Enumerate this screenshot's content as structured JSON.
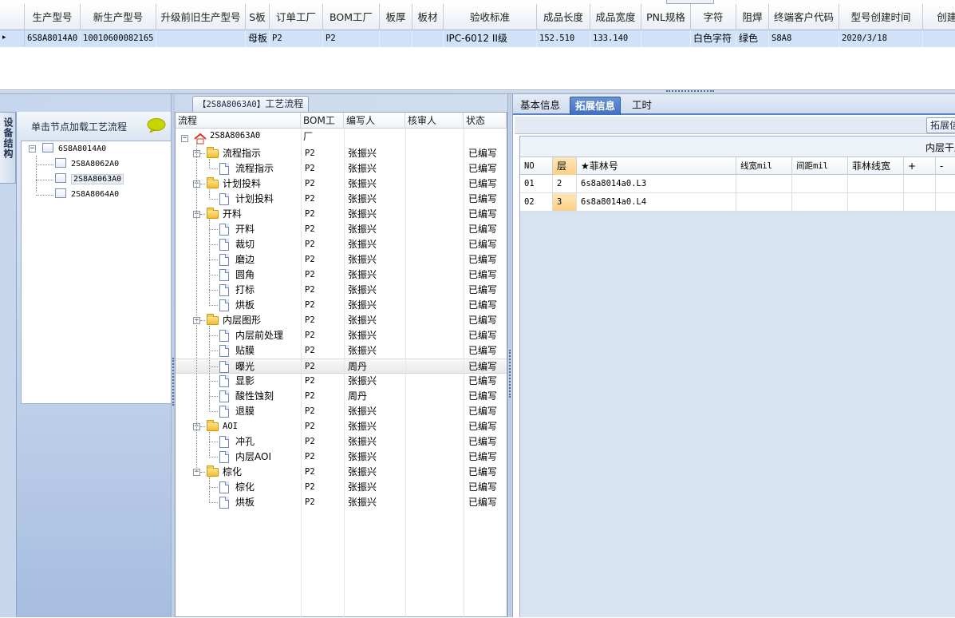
{
  "top_grid": {
    "columns": [
      "生产型号",
      "新生产型号",
      "升级前旧生产型号",
      "S板",
      "订单工厂",
      "BOM工厂",
      "板厚",
      "板材",
      "验收标准",
      "成品长度",
      "成品宽度",
      "PNL规格",
      "字符",
      "阻焊",
      "终端客户代码",
      "型号创建时间",
      "创建人"
    ],
    "row": [
      "6S8A8014A0",
      "10010600082165",
      "",
      "母板",
      "P2",
      "P2",
      "",
      "",
      "IPC-6012 II级",
      "152.510",
      "133.140",
      "",
      "白色字符",
      "绿色",
      "S8A8",
      "2020/3/18",
      ""
    ],
    "row_indicator": "▸"
  },
  "left_panel": {
    "side_tab": "设备结构",
    "header_label": "单击节点加载工艺流程",
    "tree": [
      {
        "label": "6S8A8014A0",
        "level": 0,
        "selected": false
      },
      {
        "label": "2S8A8062A0",
        "level": 1,
        "selected": false
      },
      {
        "label": "2S8A8063A0",
        "level": 1,
        "selected": true
      },
      {
        "label": "2S8A8064A0",
        "level": 1,
        "selected": false
      }
    ]
  },
  "middle_panel": {
    "tab_code": "【2S8A8063A0】",
    "tab_title": "工艺流程",
    "columns": [
      "流程",
      "BOM工厂",
      "编写人",
      "核审人",
      "状态"
    ],
    "root": "2S8A8063A0",
    "rows": [
      {
        "name": "流程指示",
        "type": "folder",
        "bom": "P2",
        "author": "张振兴",
        "reviewer": "",
        "status": "已编写"
      },
      {
        "name": "流程指示",
        "type": "item",
        "bom": "P2",
        "author": "张振兴",
        "reviewer": "",
        "status": "已编写"
      },
      {
        "name": "计划投料",
        "type": "folder",
        "bom": "P2",
        "author": "张振兴",
        "reviewer": "",
        "status": "已编写"
      },
      {
        "name": "计划投料",
        "type": "item",
        "bom": "P2",
        "author": "张振兴",
        "reviewer": "",
        "status": "已编写"
      },
      {
        "name": "开料",
        "type": "folder",
        "bom": "P2",
        "author": "张振兴",
        "reviewer": "",
        "status": "已编写"
      },
      {
        "name": "开料",
        "type": "item",
        "bom": "P2",
        "author": "张振兴",
        "reviewer": "",
        "status": "已编写"
      },
      {
        "name": "裁切",
        "type": "item",
        "bom": "P2",
        "author": "张振兴",
        "reviewer": "",
        "status": "已编写"
      },
      {
        "name": "磨边",
        "type": "item",
        "bom": "P2",
        "author": "张振兴",
        "reviewer": "",
        "status": "已编写"
      },
      {
        "name": "圆角",
        "type": "item",
        "bom": "P2",
        "author": "张振兴",
        "reviewer": "",
        "status": "已编写"
      },
      {
        "name": "打标",
        "type": "item",
        "bom": "P2",
        "author": "张振兴",
        "reviewer": "",
        "status": "已编写"
      },
      {
        "name": "烘板",
        "type": "item",
        "bom": "P2",
        "author": "张振兴",
        "reviewer": "",
        "status": "已编写"
      },
      {
        "name": "内层图形",
        "type": "folder",
        "bom": "P2",
        "author": "张振兴",
        "reviewer": "",
        "status": "已编写"
      },
      {
        "name": "内层前处理",
        "type": "item",
        "bom": "P2",
        "author": "张振兴",
        "reviewer": "",
        "status": "已编写"
      },
      {
        "name": "贴膜",
        "type": "item",
        "bom": "P2",
        "author": "张振兴",
        "reviewer": "",
        "status": "已编写"
      },
      {
        "name": "曝光",
        "type": "item",
        "bom": "P2",
        "author": "周丹",
        "reviewer": "",
        "status": "已编写",
        "highlight": true
      },
      {
        "name": "显影",
        "type": "item",
        "bom": "P2",
        "author": "张振兴",
        "reviewer": "",
        "status": "已编写"
      },
      {
        "name": "酸性蚀刻",
        "type": "item",
        "bom": "P2",
        "author": "周丹",
        "reviewer": "",
        "status": "已编写"
      },
      {
        "name": "退膜",
        "type": "item",
        "bom": "P2",
        "author": "张振兴",
        "reviewer": "",
        "status": "已编写"
      },
      {
        "name": "AOI",
        "type": "folder",
        "bom": "P2",
        "author": "张振兴",
        "reviewer": "",
        "status": "已编写"
      },
      {
        "name": "冲孔",
        "type": "item",
        "bom": "P2",
        "author": "张振兴",
        "reviewer": "",
        "status": "已编写"
      },
      {
        "name": "内层AOI",
        "type": "item",
        "bom": "P2",
        "author": "张振兴",
        "reviewer": "",
        "status": "已编写"
      },
      {
        "name": "棕化",
        "type": "folder",
        "bom": "P2",
        "author": "张振兴",
        "reviewer": "",
        "status": "已编写"
      },
      {
        "name": "棕化",
        "type": "item",
        "bom": "P2",
        "author": "张振兴",
        "reviewer": "",
        "status": "已编写"
      },
      {
        "name": "烘板",
        "type": "item",
        "bom": "P2",
        "author": "张振兴",
        "reviewer": "",
        "status": "已编写"
      }
    ]
  },
  "right_panel": {
    "tabs": [
      "基本信息",
      "拓展信息",
      "工时"
    ],
    "active_tab": "拓展信息",
    "sub_button": "拓展信息",
    "inner_title": "内层干膜",
    "columns": [
      "NO",
      "层",
      "★菲林号",
      "线宽mil",
      "间距mil",
      "菲林线宽",
      "+",
      "-"
    ],
    "rows": [
      [
        "01",
        "2",
        "6s8a8014a0.L3",
        "",
        "",
        "",
        "",
        ""
      ],
      [
        "02",
        "3",
        "6s8a8014a0.L4",
        "",
        "",
        "",
        "",
        ""
      ]
    ]
  },
  "icons": {
    "folder": "folder-icon",
    "document": "document-icon",
    "home": "home-icon",
    "bubble": "speech-bubble-icon"
  },
  "colors": {
    "selection": "#cfe2f8",
    "active_tab": "#4a78c8",
    "panel_bg": "#c6d6ec"
  }
}
